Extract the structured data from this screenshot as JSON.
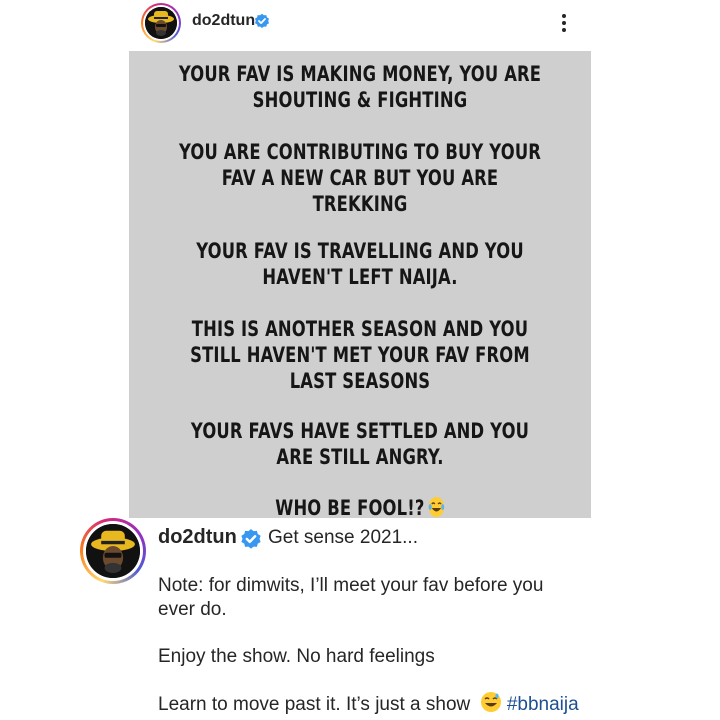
{
  "header": {
    "username": "do2dtun",
    "verified_icon": "verified-badge-icon",
    "more_icon": "more-vertical-icon"
  },
  "post": {
    "background": "#cfcfcf",
    "paragraphs": [
      "YOUR FAV IS MAKING MONEY, YOU ARE\nSHOUTING & FIGHTING",
      "YOU ARE CONTRIBUTING TO BUY YOUR\nFAV A NEW CAR BUT YOU ARE\nTREKKING",
      "YOUR FAV IS TRAVELLING AND YOU\nHAVEN'T LEFT NAIJA.",
      "THIS IS ANOTHER SEASON AND YOU\nSTILL HAVEN'T MET YOUR FAV FROM\nLAST SEASONS",
      "YOUR FAVS HAVE SETTLED AND YOU\nARE STILL ANGRY.",
      "WHO BE FOOL!?"
    ],
    "final_emoji": "laughing-tears-emoji"
  },
  "caption": {
    "username": "do2dtun",
    "first_line": "Get sense 2021...",
    "line2a": "Note: for dimwits, I’ll meet your fav before you",
    "line2b": "ever do.",
    "line3": "Enjoy the show. No hard feelings",
    "line4": "Learn to move past it. It’s just a show",
    "hashtag": "#bbnaija",
    "emoji": "grinning-sweat-emoji"
  }
}
